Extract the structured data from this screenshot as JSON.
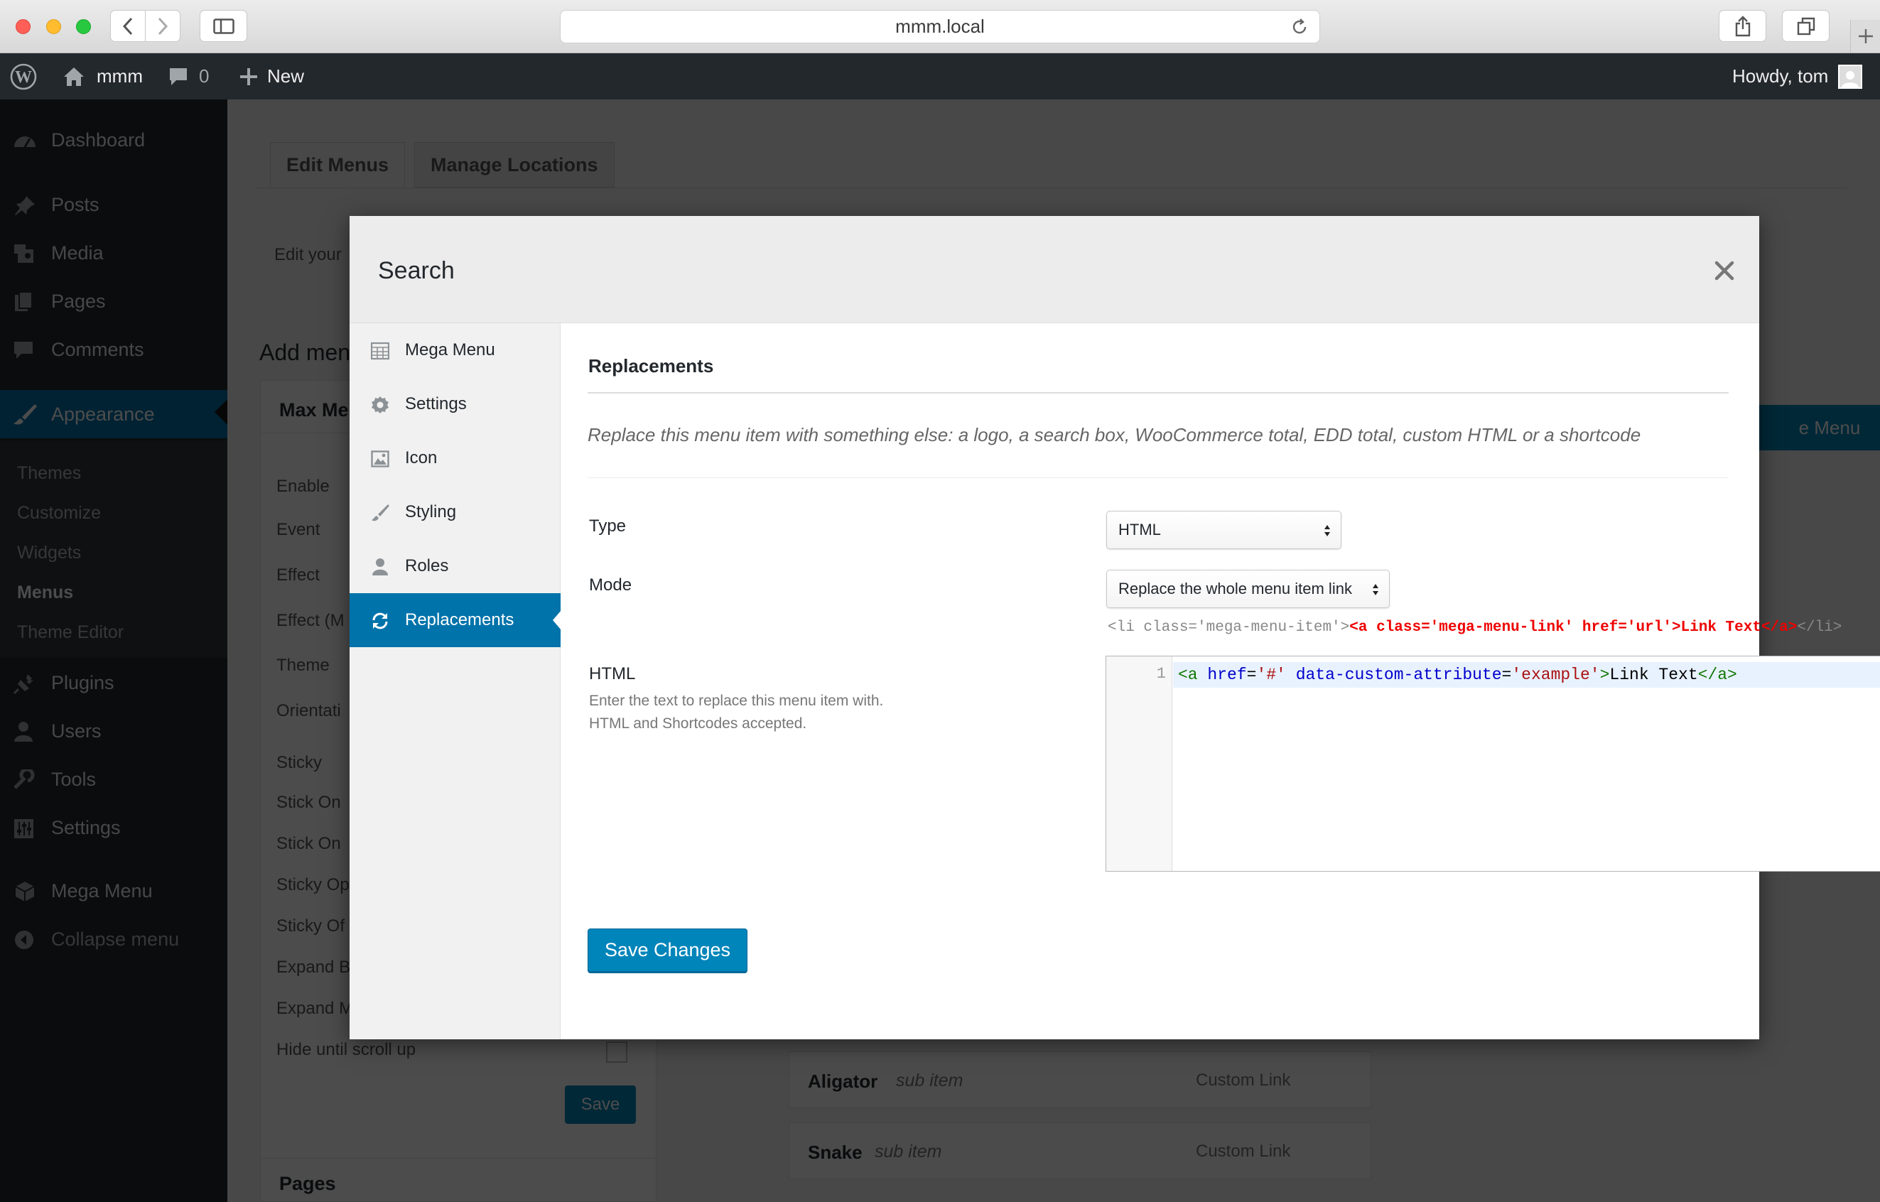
{
  "browser": {
    "url": "mmm.local"
  },
  "adminbar": {
    "site": "mmm",
    "comments": "0",
    "new": "New",
    "howdy": "Howdy, tom"
  },
  "sidebar": {
    "items": [
      {
        "label": "Dashboard",
        "icon": "dashboard-icon"
      },
      {
        "label": "Posts",
        "icon": "pin-icon"
      },
      {
        "label": "Media",
        "icon": "media-icon"
      },
      {
        "label": "Pages",
        "icon": "pages-icon"
      },
      {
        "label": "Comments",
        "icon": "comment-icon"
      },
      {
        "label": "Appearance",
        "icon": "brush-icon"
      },
      {
        "label": "Plugins",
        "icon": "plug-icon"
      },
      {
        "label": "Users",
        "icon": "user-icon"
      },
      {
        "label": "Tools",
        "icon": "wrench-icon"
      },
      {
        "label": "Settings",
        "icon": "sliders-icon"
      },
      {
        "label": "Mega Menu",
        "icon": "cube-icon"
      },
      {
        "label": "Collapse menu",
        "icon": "collapse-icon"
      }
    ],
    "submenu": [
      "Themes",
      "Customize",
      "Widgets",
      "Menus",
      "Theme Editor"
    ]
  },
  "background": {
    "tabs": [
      "Edit Menus",
      "Manage Locations"
    ],
    "edit_text": "Edit your",
    "add_heading": "Add men",
    "box_title": "Max Me",
    "settings": [
      "Enable",
      "Event",
      "Effect",
      "Effect (M",
      "Theme",
      "Orientati",
      "Sticky",
      "Stick On",
      "Stick On",
      "Sticky Op",
      "Sticky Of",
      "Expand B",
      "Expand M",
      "Hide until scroll up"
    ],
    "save": "Save",
    "pages_box": "Pages",
    "menu_button": "e Menu",
    "items": [
      {
        "name": "Aligator",
        "sub": "sub item",
        "type": "Custom Link"
      },
      {
        "name": "Snake",
        "sub": "sub item",
        "type": "Custom Link"
      }
    ]
  },
  "modal": {
    "title": "Search",
    "tabs": [
      {
        "label": "Mega Menu",
        "icon": "grid-icon"
      },
      {
        "label": "Settings",
        "icon": "gear-icon"
      },
      {
        "label": "Icon",
        "icon": "image-icon"
      },
      {
        "label": "Styling",
        "icon": "brush-icon"
      },
      {
        "label": "Roles",
        "icon": "user-icon"
      },
      {
        "label": "Replacements",
        "icon": "refresh-icon"
      }
    ],
    "active_tab": "Replacements",
    "panel": {
      "title": "Replacements",
      "description": "Replace this menu item with something else: a logo, a search box, WooCommerce total, EDD total, custom HTML or a shortcode",
      "type_label": "Type",
      "type_value": "HTML",
      "mode_label": "Mode",
      "mode_value": "Replace the whole menu item link",
      "preview": {
        "prefix": "<li class='mega-menu-item'>",
        "highlight": "<a class='mega-menu-link' href='url'>Link Text</a>",
        "suffix": "</li>"
      },
      "html_label": "HTML",
      "html_description": "Enter the text to replace this menu item with. HTML and Shortcodes accepted.",
      "editor": {
        "line_number": "1",
        "tokens": [
          "<a",
          "href",
          "=",
          "'#'",
          "data-custom-attribute",
          "=",
          "'example'",
          ">",
          "Link Text",
          "</a>"
        ]
      },
      "save_label": "Save Changes"
    }
  },
  "colors": {
    "accent": "#0073aa",
    "adminbar": "#23282d",
    "button": "#0085ba"
  }
}
